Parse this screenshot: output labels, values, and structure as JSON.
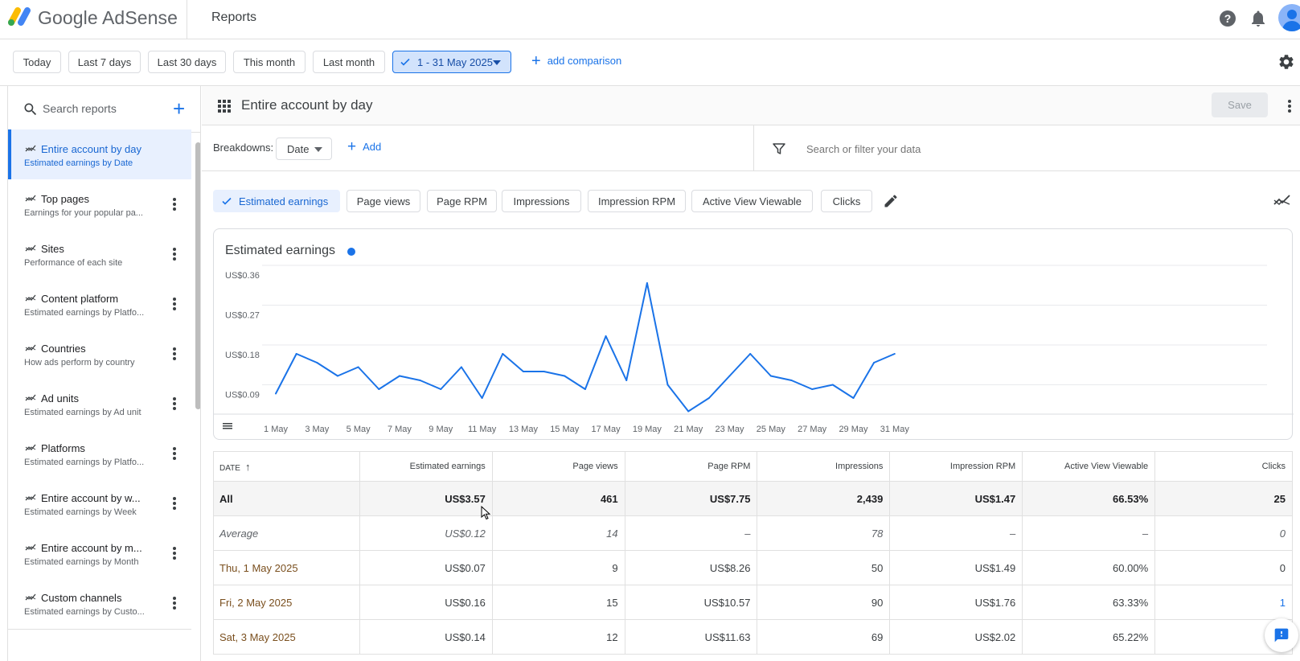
{
  "app": {
    "brand": "Google AdSense",
    "page_title": "Reports"
  },
  "colors": {
    "accent": "#1a73e8",
    "selected_bg": "#e8f0fe",
    "line": "#1a73e8"
  },
  "date_range": {
    "presets": [
      "Today",
      "Last 7 days",
      "Last 30 days",
      "This month",
      "Last month"
    ],
    "selected": "1 - 31 May 2025",
    "add_comparison": "add comparison"
  },
  "sidebar": {
    "search_placeholder": "Search reports",
    "items": [
      {
        "title": "Entire account by day",
        "subtitle": "Estimated earnings by Date",
        "active": true
      },
      {
        "title": "Top pages",
        "subtitle": "Earnings for your popular pa..."
      },
      {
        "title": "Sites",
        "subtitle": "Performance of each site"
      },
      {
        "title": "Content platform",
        "subtitle": "Estimated earnings by Platfo..."
      },
      {
        "title": "Countries",
        "subtitle": "How ads perform by country"
      },
      {
        "title": "Ad units",
        "subtitle": "Estimated earnings by Ad unit"
      },
      {
        "title": "Platforms",
        "subtitle": "Estimated earnings by Platfo..."
      },
      {
        "title": "Entire account by w...",
        "subtitle": "Estimated earnings by Week"
      },
      {
        "title": "Entire account by m...",
        "subtitle": "Estimated earnings by Month"
      },
      {
        "title": "Custom channels",
        "subtitle": "Estimated earnings by Custo..."
      }
    ]
  },
  "report": {
    "title": "Entire account by day",
    "save_label": "Save",
    "breakdowns_label": "Breakdowns:",
    "breakdown_value": "Date",
    "add_label": "Add",
    "filter_placeholder": "Search or filter your data"
  },
  "metrics": [
    {
      "label": "Estimated earnings",
      "selected": true
    },
    {
      "label": "Page views"
    },
    {
      "label": "Page RPM"
    },
    {
      "label": "Impressions"
    },
    {
      "label": "Impression RPM"
    },
    {
      "label": "Active View Viewable"
    },
    {
      "label": "Clicks"
    }
  ],
  "chart_data": {
    "type": "line",
    "title": "Estimated earnings",
    "y_tick_labels": [
      "US$0.36",
      "US$0.27",
      "US$0.18",
      "US$0.09"
    ],
    "y_ticks": [
      0.36,
      0.27,
      0.18,
      0.09
    ],
    "ylim": [
      0,
      0.36
    ],
    "x_tick_labels": [
      "1 May",
      "3 May",
      "5 May",
      "7 May",
      "9 May",
      "11 May",
      "13 May",
      "15 May",
      "17 May",
      "19 May",
      "21 May",
      "23 May",
      "25 May",
      "27 May",
      "29 May",
      "31 May"
    ],
    "grid": true,
    "series": [
      {
        "values": [
          0.07,
          0.16,
          0.14,
          0.11,
          0.13,
          0.08,
          0.11,
          0.1,
          0.08,
          0.13,
          0.06,
          0.16,
          0.12,
          0.12,
          0.11,
          0.08,
          0.2,
          0.1,
          0.32,
          0.09,
          0.03,
          0.06,
          0.11,
          0.16,
          0.11,
          0.1,
          0.08,
          0.09,
          0.06,
          0.14,
          0.16
        ]
      }
    ]
  },
  "table": {
    "columns": [
      "DATE",
      "Estimated earnings",
      "Page views",
      "Page RPM",
      "Impressions",
      "Impression RPM",
      "Active View Viewable",
      "Clicks"
    ],
    "total": [
      "All",
      "US$3.57",
      "461",
      "US$7.75",
      "2,439",
      "US$1.47",
      "66.53%",
      "25"
    ],
    "average": [
      "Average",
      "US$0.12",
      "14",
      "–",
      "78",
      "–",
      "–",
      "0"
    ],
    "rows": [
      [
        "Thu, 1 May 2025",
        "US$0.07",
        "9",
        "US$8.26",
        "50",
        "US$1.49",
        "60.00%",
        "0"
      ],
      [
        "Fri, 2 May 2025",
        "US$0.16",
        "15",
        "US$10.57",
        "90",
        "US$1.76",
        "63.33%",
        "1"
      ],
      [
        "Sat, 3 May 2025",
        "US$0.14",
        "12",
        "US$11.63",
        "69",
        "US$2.02",
        "65.22%",
        ""
      ]
    ]
  },
  "icons": [
    "help-icon",
    "notifications-icon",
    "settings-icon",
    "search-icon",
    "apps-icon",
    "filter-icon",
    "edit-icon",
    "trend-icon",
    "feedback-icon",
    "more-vert-icon"
  ]
}
